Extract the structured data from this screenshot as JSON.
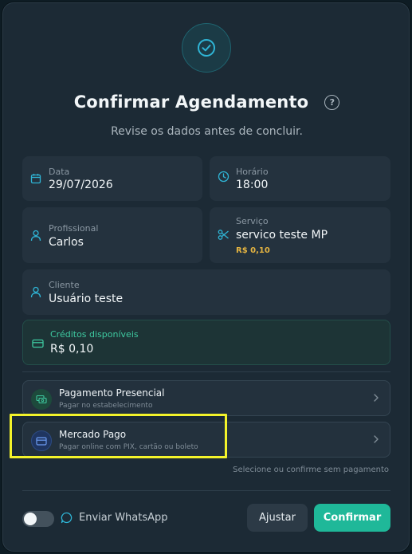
{
  "colors": {
    "accent": "#1fb899",
    "price": "#e3b341",
    "highlight": "#f3f32a",
    "icon_cyan": "#2fb5d6"
  },
  "header": {
    "icon": "check-circle-icon",
    "title": "Confirmar Agendamento",
    "help_icon_glyph": "?",
    "subtitle": "Revise os dados antes de concluir."
  },
  "details": {
    "date": {
      "label": "Data",
      "value": "29/07/2026",
      "icon": "calendar-icon"
    },
    "time": {
      "label": "Horário",
      "value": "18:00",
      "icon": "clock-icon"
    },
    "professional": {
      "label": "Profissional",
      "value": "Carlos",
      "icon": "user-icon"
    },
    "service": {
      "label": "Serviço",
      "value": "servico teste MP",
      "price": "R$ 0,10",
      "icon": "scissors-icon"
    },
    "client": {
      "label": "Cliente",
      "value": "Usuário teste",
      "icon": "user-icon"
    }
  },
  "credits": {
    "label": "Créditos disponíveis",
    "value": "R$ 0,10",
    "icon": "credit-card-icon"
  },
  "payment_options": [
    {
      "title": "Pagamento Presencial",
      "subtitle": "Pagar no estabelecimento",
      "icon": "cash-icon"
    },
    {
      "title": "Mercado Pago",
      "subtitle": "Pagar online com PIX, cartão ou boleto",
      "icon": "credit-card-icon"
    }
  ],
  "payment_note": "Selecione ou confirme sem pagamento",
  "footer": {
    "whatsapp_label": "Enviar WhatsApp",
    "whatsapp_enabled": false,
    "adjust_label": "Ajustar",
    "confirm_label": "Confirmar"
  }
}
